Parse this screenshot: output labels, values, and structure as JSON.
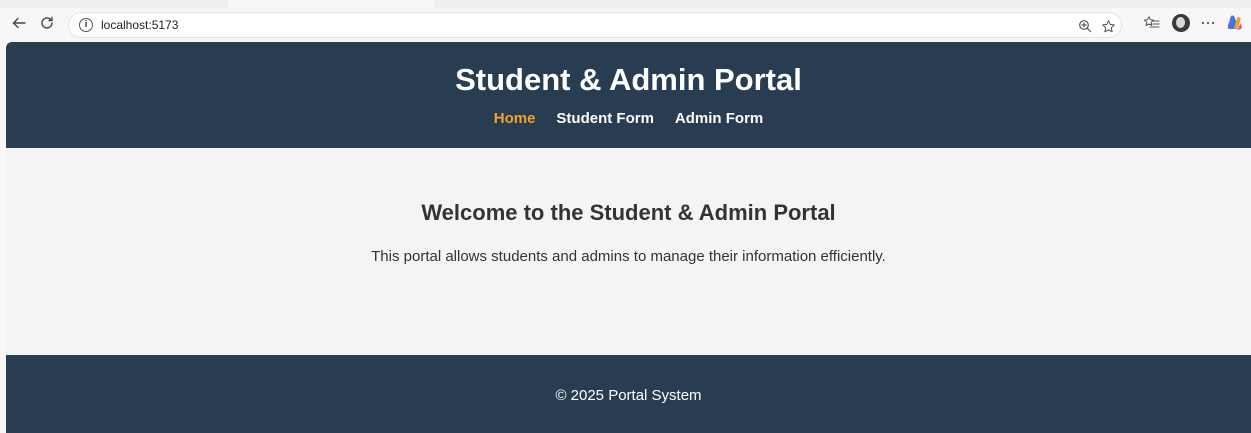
{
  "browser": {
    "url": "localhost:5173",
    "icons": {
      "back": "back-arrow-icon",
      "reload": "reload-icon",
      "site_info": "info-icon",
      "zoom": "zoom-icon",
      "favorite": "star-icon",
      "favorites_list": "favorites-list-icon",
      "profile": "avatar",
      "more": "more-icon",
      "copilot": "copilot-icon"
    }
  },
  "header": {
    "title": "Student & Admin Portal",
    "nav": [
      {
        "label": "Home",
        "active": true
      },
      {
        "label": "Student Form",
        "active": false
      },
      {
        "label": "Admin Form",
        "active": false
      }
    ]
  },
  "main": {
    "heading": "Welcome to the Student & Admin Portal",
    "text": "This portal allows students and admins to manage their information efficiently."
  },
  "footer": {
    "text": "© 2025 Portal System"
  },
  "colors": {
    "header_bg": "#283d52",
    "active_link": "#f0a22a",
    "body_bg": "#f4f4f4",
    "text": "#333333"
  }
}
